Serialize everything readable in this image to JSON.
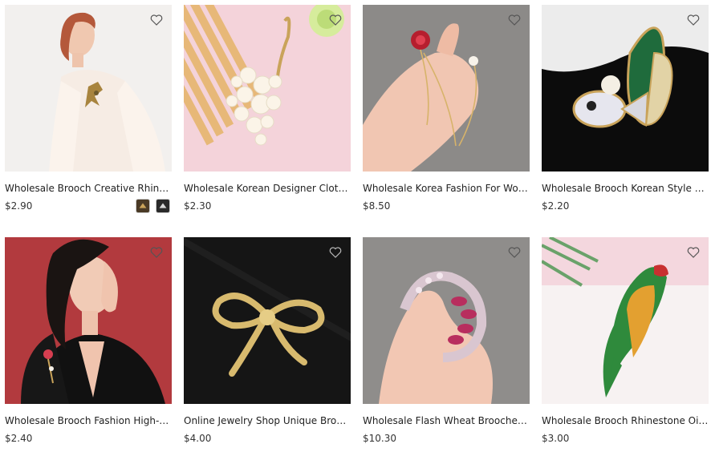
{
  "products": [
    {
      "title": "Wholesale Brooch Creative Rhinest...",
      "price": "$2.90",
      "image": "woman-white-blazer-gold-brooch",
      "favorite_icon": "heart-outline-icon"
    },
    {
      "title": "Wholesale Korean Designer Clothin...",
      "price": "$2.30",
      "image": "pearl-peacock-brooch",
      "favorite_icon": "heart-outline-icon"
    },
    {
      "title": "Wholesale Korea Fashion For Wome...",
      "price": "$8.50",
      "image": "rose-chain-brooch-in-hand",
      "favorite_icon": "heart-outline-icon"
    },
    {
      "title": "Wholesale Brooch Korean Style Cry...",
      "price": "$2.20",
      "image": "green-fish-crystal-brooch",
      "favorite_icon": "heart-outline-icon"
    },
    {
      "title": "Wholesale Brooch Fashion High-end...",
      "price": "$2.40",
      "image": "woman-black-blazer-rose-brooch",
      "favorite_icon": "heart-outline-icon"
    },
    {
      "title": "Online Jewelry Shop Unique Brooch...",
      "price": "$4.00",
      "image": "gold-bow-brooch",
      "favorite_icon": "heart-outline-icon"
    },
    {
      "title": "Wholesale Flash Wheat Brooches W...",
      "price": "$10.30",
      "image": "pink-wheat-wreath-brooch-in-hand",
      "favorite_icon": "heart-outline-icon"
    },
    {
      "title": "Wholesale Brooch Rhinestone Oil D...",
      "price": "$3.00",
      "image": "enamel-parrot-brooch",
      "favorite_icon": "heart-outline-icon"
    }
  ]
}
